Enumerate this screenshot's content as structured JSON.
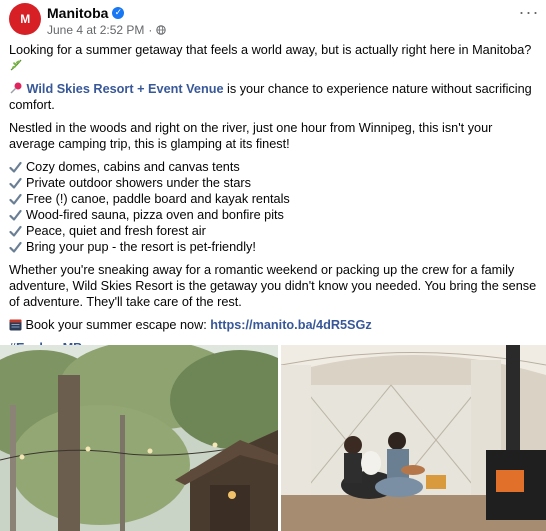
{
  "page": {
    "name": "Manitoba",
    "avatar_text": "M"
  },
  "meta": {
    "date": "June 4 at 2:52 PM",
    "separator": "·"
  },
  "header": {
    "more_label": "···"
  },
  "post": {
    "intro": "Looking for a summer getaway that feels a world away, but is actually right here in Manitoba?",
    "resort_link": "Wild Skies Resort + Event Venue",
    "resort_rest": " is your chance to experience nature without sacrificing comfort.",
    "para2": "Nestled in the woods and right on the river, just one hour from Winnipeg, this isn't your average camping trip, this is glamping at its finest!",
    "features": [
      "Cozy domes, cabins and canvas tents",
      "Private outdoor showers under the stars",
      "Free (!) canoe, paddle board and kayak rentals",
      "Wood-fired sauna, pizza oven and bonfire pits",
      "Peace, quiet and fresh forest air",
      "Bring your pup - the resort is pet-friendly!"
    ],
    "para3": "Whether you're sneaking away for a romantic weekend or packing up the crew for a family adventure, Wild Skies Resort is the getaway you didn't know you needed. You bring the sense of adventure. They'll take care of the rest.",
    "book_text": "Book your summer escape now: ",
    "book_link": "https://manito.ba/4dR5SGz",
    "hashtag": "#ExploreMB"
  },
  "icons": {
    "verified": "verified-badge-icon",
    "globe": "globe-icon",
    "more": "more-options-icon",
    "herb": "herb-emoji-icon",
    "pin": "pushpin-emoji-icon",
    "check": "check-mark-icon",
    "calendar": "calendar-emoji-icon"
  },
  "colors": {
    "link": "#385898",
    "meta": "#65676b",
    "brand": "#d71f26",
    "verified": "#1877f2"
  }
}
